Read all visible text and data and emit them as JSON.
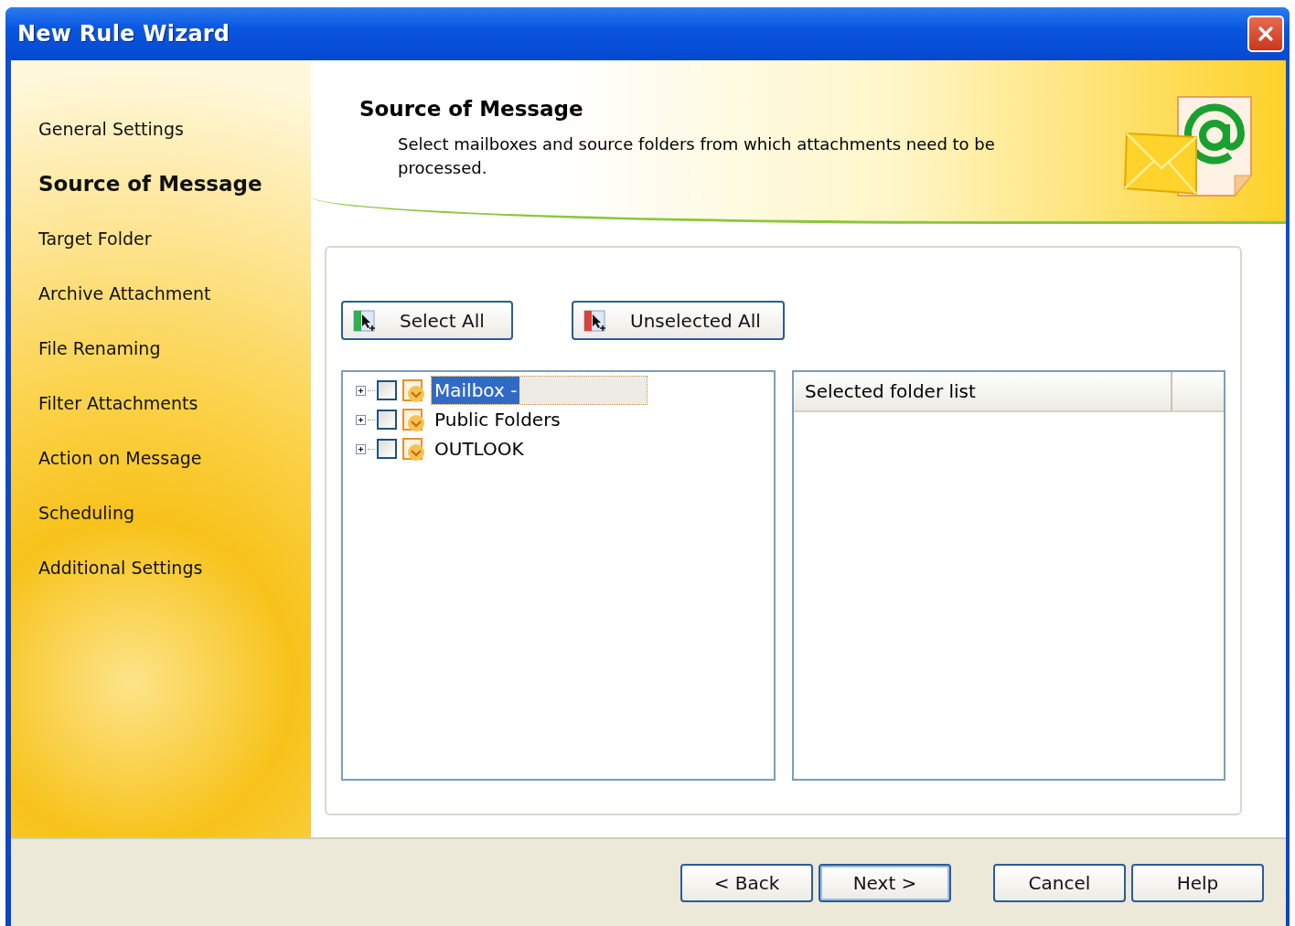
{
  "window": {
    "title": "New Rule Wizard"
  },
  "steps": [
    {
      "label": "General Settings",
      "selected": false
    },
    {
      "label": "Source of Message",
      "selected": true
    },
    {
      "label": "Target Folder",
      "selected": false
    },
    {
      "label": "Archive Attachment",
      "selected": false
    },
    {
      "label": "File Renaming",
      "selected": false
    },
    {
      "label": "Filter Attachments",
      "selected": false
    },
    {
      "label": "Action on Message",
      "selected": false
    },
    {
      "label": "Scheduling",
      "selected": false
    },
    {
      "label": "Additional Settings",
      "selected": false
    }
  ],
  "header": {
    "title": "Source of Message",
    "description": "Select mailboxes and source folders from which attachments need to be processed."
  },
  "actions": [
    {
      "label": "Select All",
      "kind": "select"
    },
    {
      "label": "Unselected All",
      "kind": "unselect"
    }
  ],
  "tree": [
    {
      "label": "Mailbox -",
      "checked": false,
      "expanded": false,
      "selected": true
    },
    {
      "label": "Public Folders",
      "checked": false,
      "expanded": false,
      "selected": false
    },
    {
      "label": "OUTLOOK",
      "checked": false,
      "expanded": false,
      "selected": false
    }
  ],
  "selected_list": {
    "columns": [
      "Selected folder list"
    ]
  },
  "footer_buttons": [
    {
      "label": "< Back",
      "default": false
    },
    {
      "label": "Next >",
      "default": true
    },
    {
      "label": "Cancel",
      "default": false
    },
    {
      "label": "Help",
      "default": false
    }
  ]
}
